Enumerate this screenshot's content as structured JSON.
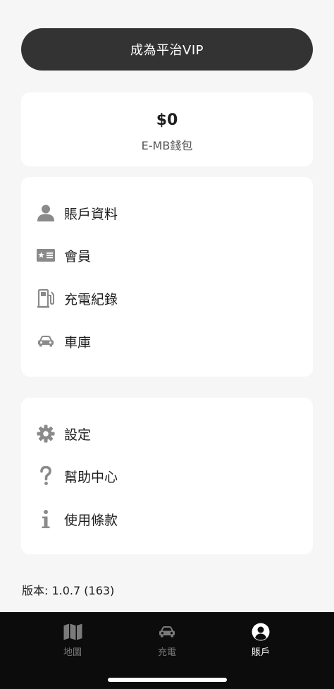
{
  "vip_button": {
    "label": "成為平治VIP"
  },
  "wallet": {
    "amount": "$0",
    "label": "E-MB錢包"
  },
  "menu_group_1": [
    {
      "label": "賬戶資料",
      "icon": "person-icon"
    },
    {
      "label": "會員",
      "icon": "member-card-icon"
    },
    {
      "label": "充電紀錄",
      "icon": "fuel-pump-icon"
    },
    {
      "label": "車庫",
      "icon": "car-icon"
    }
  ],
  "menu_group_2": [
    {
      "label": "設定",
      "icon": "gear-icon"
    },
    {
      "label": "幫助中心",
      "icon": "question-icon"
    },
    {
      "label": "使用條款",
      "icon": "info-icon"
    }
  ],
  "version": "版本: 1.0.7 (163)",
  "tabbar": {
    "tabs": [
      {
        "label": "地圖",
        "icon": "map-icon",
        "active": false
      },
      {
        "label": "充電",
        "icon": "car-icon",
        "active": false
      },
      {
        "label": "賬戶",
        "icon": "account-icon",
        "active": true
      }
    ]
  },
  "colors": {
    "background": "#f6f6f6",
    "card": "#ffffff",
    "vip_button": "#333333",
    "icon_gray": "#8a8a8a",
    "tabbar": "#0c0c0c",
    "tab_inactive": "#7a7a7a",
    "tab_active": "#ffffff"
  }
}
